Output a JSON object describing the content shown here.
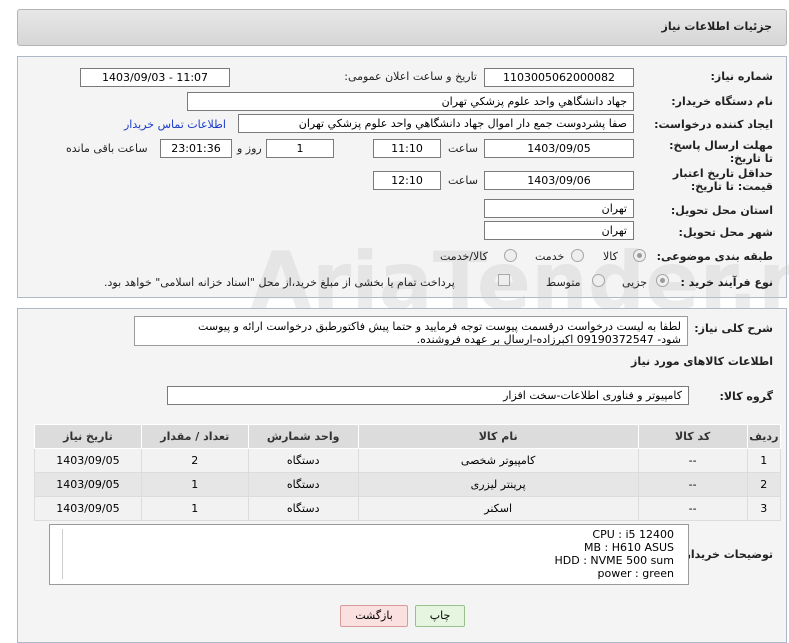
{
  "header": {
    "title": "جزئیات اطلاعات نیاز"
  },
  "form": {
    "need_number_label": "شماره نیاز:",
    "need_number": "1103005062000082",
    "announce_label": "تاریخ و ساعت اعلان عمومی:",
    "announce_value": "1403/09/03 - 11:07",
    "buyer_org_label": "نام دستگاه خریدار:",
    "buyer_org": "جهاد دانشگاهي واحد علوم پزشکي تهران",
    "creator_label": "ایجاد کننده درخواست:",
    "creator": "صفا پشردوست جمع دار اموال  جهاد دانشگاهي واحد علوم پزشکي تهران",
    "contact_link": "اطلاعات تماس خریدار",
    "reply_deadline_label": "مهلت ارسال پاسخ: تا تاریخ:",
    "reply_date": "1403/09/05",
    "time_label": "ساعت",
    "reply_time": "11:10",
    "days_value": "1",
    "days_label": "روز و",
    "remaining_time": "23:01:36",
    "remaining_label": "ساعت باقی مانده",
    "price_validity_label": "حداقل تاریخ اعتبار قیمت: تا تاریخ:",
    "validity_date": "1403/09/06",
    "validity_time": "12:10",
    "province_label": "استان محل تحویل:",
    "province": "تهران",
    "city_label": "شهر محل تحویل:",
    "city": "تهران",
    "category_label": "طبقه بندی موضوعی:",
    "category_options": [
      "کالا",
      "خدمت",
      "کالا/خدمت"
    ],
    "process_label": "نوع فرآیند خرید :",
    "process_options": [
      "جزیی",
      "متوسط"
    ],
    "payment_note": "پرداخت تمام یا بخشی از مبلغ خرید،از محل \"اسناد خزانه اسلامی\" خواهد بود."
  },
  "summary": {
    "label": "شرح کلی نیاز:",
    "text_line1": "لطفا به لیست درخواست درقسمت پیوست توجه فرمایید و حتما پیش فاکتورطبق درخواست ارائه و پیوست",
    "text_line2": "شود- 09190372547 اکبرزاده-ارسال بر عهده فروشنده."
  },
  "goods": {
    "section_title": "اطلاعات کالاهای مورد نیاز",
    "group_label": "گروه کالا:",
    "group_value": "کامپیوتر و فناوری اطلاعات-سخت افزار",
    "columns": [
      "ردیف",
      "کد کالا",
      "نام کالا",
      "واحد شمارش",
      "تعداد / مقدار",
      "تاریخ نیاز"
    ],
    "rows": [
      [
        "1",
        "--",
        "کامپیوتر شخصی",
        "دستگاه",
        "2",
        "1403/09/05"
      ],
      [
        "2",
        "--",
        "پرینتر لیزری",
        "دستگاه",
        "1",
        "1403/09/05"
      ],
      [
        "3",
        "--",
        "اسکنر",
        "دستگاه",
        "1",
        "1403/09/05"
      ]
    ]
  },
  "buyer_notes": {
    "label": "توضیحات خریدار:",
    "lines": [
      "CPU : i5 12400",
      "MB  : H610 ASUS",
      "HDD : NVME 500 sum",
      "power : green"
    ]
  },
  "buttons": {
    "print": "چاپ",
    "back": "بازگشت"
  },
  "watermark": "AriaTender.net"
}
